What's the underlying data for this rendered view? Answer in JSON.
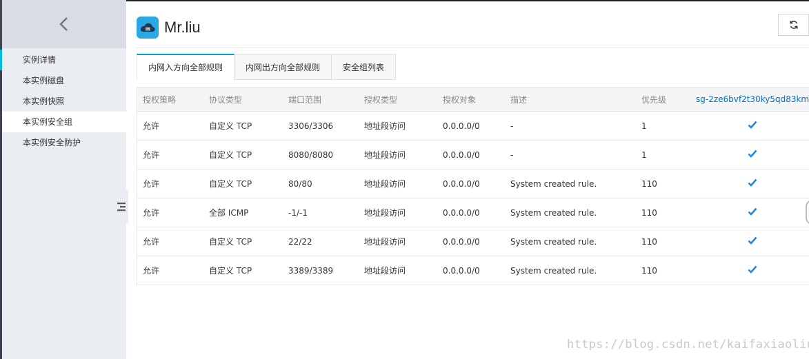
{
  "sidebar": {
    "items": [
      {
        "label": "实例详情"
      },
      {
        "label": "本实例磁盘"
      },
      {
        "label": "本实例快照"
      },
      {
        "label": "本实例安全组"
      },
      {
        "label": "本实例安全防护"
      }
    ],
    "active_index": 3,
    "accent_color": "#00c1de"
  },
  "header": {
    "title": "Mr.liu",
    "icon": "cloud-server-icon",
    "refresh_icon": "refresh-icon"
  },
  "tabs": [
    {
      "label": "内网入方向全部规则"
    },
    {
      "label": "内网出方向全部规则"
    },
    {
      "label": "安全组列表"
    }
  ],
  "table": {
    "columns": [
      "授权策略",
      "协议类型",
      "端口范围",
      "授权类型",
      "授权对象",
      "描述",
      "优先级",
      "sg-2ze6bvf2t30ky5qd83km"
    ],
    "rows": [
      [
        "允许",
        "自定义 TCP",
        "3306/3306",
        "地址段访问",
        "0.0.0.0/0",
        "-",
        "1"
      ],
      [
        "允许",
        "自定义 TCP",
        "8080/8080",
        "地址段访问",
        "0.0.0.0/0",
        "-",
        "1"
      ],
      [
        "允许",
        "自定义 TCP",
        "80/80",
        "地址段访问",
        "0.0.0.0/0",
        "System created rule.",
        "110"
      ],
      [
        "允许",
        "全部 ICMP",
        "-1/-1",
        "地址段访问",
        "0.0.0.0/0",
        "System created rule.",
        "110"
      ],
      [
        "允许",
        "自定义 TCP",
        "22/22",
        "地址段访问",
        "0.0.0.0/0",
        "System created rule.",
        "110"
      ],
      [
        "允许",
        "自定义 TCP",
        "3389/3389",
        "地址段访问",
        "0.0.0.0/0",
        "System created rule.",
        "110"
      ]
    ],
    "check_icon": "checkmark-icon",
    "check_color": "#1e88e5",
    "link_color": "#0070cc"
  },
  "watermark": "https://blog.csdn.net/kaifaxiaoliu"
}
